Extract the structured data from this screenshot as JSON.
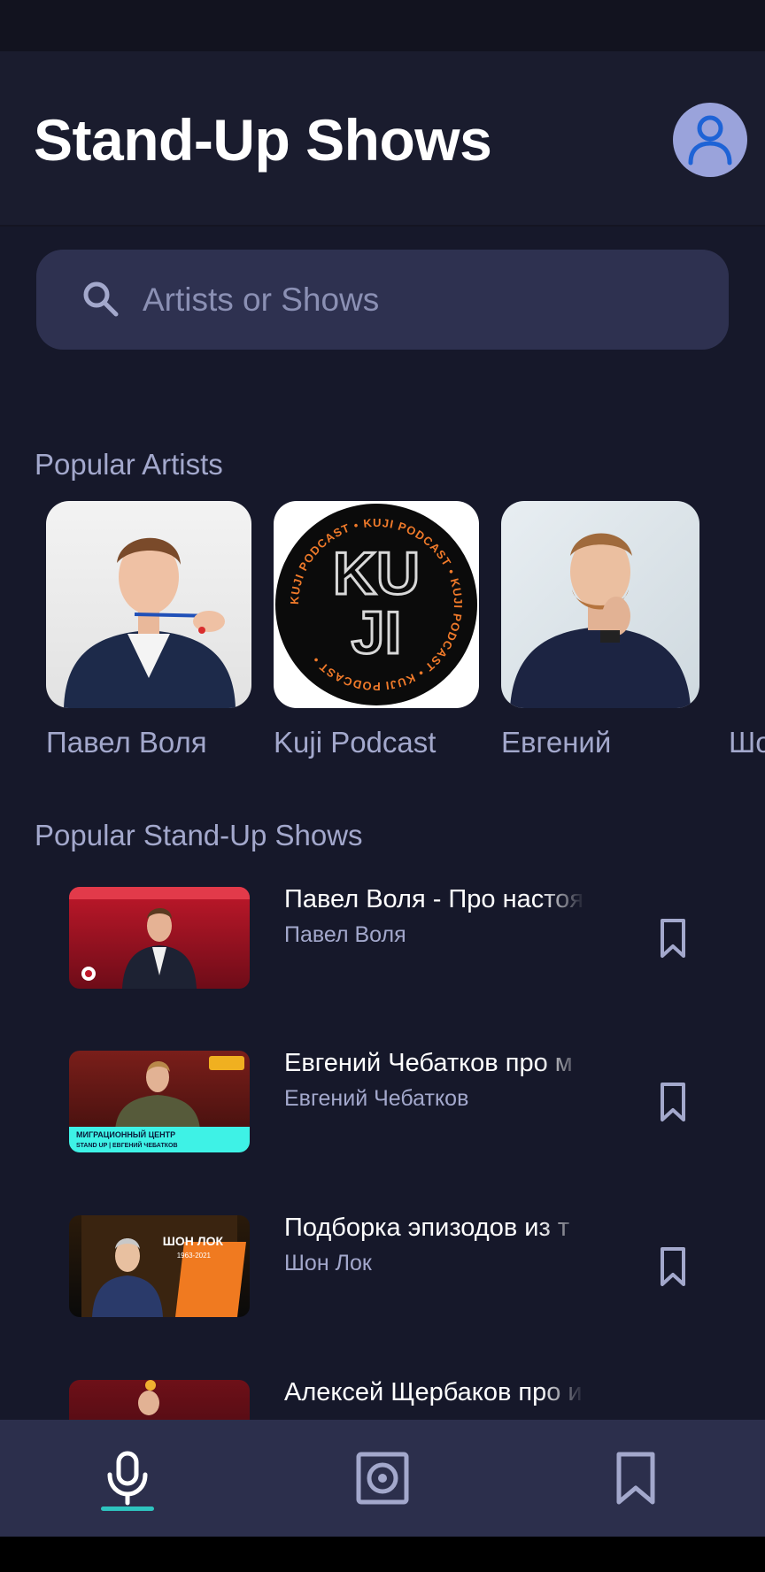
{
  "header": {
    "title": "Stand-Up Shows",
    "avatar_icon": "user-icon"
  },
  "search": {
    "placeholder": "Artists or Shows",
    "icon": "search-icon"
  },
  "sections": {
    "artists_title": "Popular Artists",
    "shows_title": "Popular Stand-Up Shows"
  },
  "artists": [
    {
      "name": "Павел Воля"
    },
    {
      "name": "Kuji Podcast",
      "logo_text": "KU JI",
      "ring_text": "KUJI PODCAST • KUJI PODCAST • KUJI PODCAST • KUJI PODCAST •"
    },
    {
      "name": "Евгений"
    },
    {
      "name": "Шо"
    }
  ],
  "shows": [
    {
      "title": "Павел Воля - Про настоя",
      "artist": "Павел Воля"
    },
    {
      "title": "Евгений Чебатков про м",
      "artist": "Евгений Чебатков",
      "thumb_caption_1": "МИГРАЦИОННЫЙ ЦЕНТР",
      "thumb_caption_2": "STAND UP | ЕВГЕНИЙ ЧЕБАТКОВ"
    },
    {
      "title": "Подборка эпизодов из т",
      "artist": "Шон Лок",
      "thumb_caption_1": "ШОН ЛОК",
      "thumb_caption_2": "1963-2021"
    },
    {
      "title": "Алексей Щербаков про и",
      "artist": ""
    }
  ],
  "bottom_nav": [
    {
      "icon": "microphone-icon",
      "active": true
    },
    {
      "icon": "speaker-icon",
      "active": false
    },
    {
      "icon": "bookmark-icon",
      "active": false
    }
  ],
  "colors": {
    "background": "#16182a",
    "header": "#1a1c2e",
    "search": "#2e3150",
    "accent": "#2ec4bf",
    "muted_text": "#a3a8cc",
    "nav": "#2c2f4c"
  }
}
